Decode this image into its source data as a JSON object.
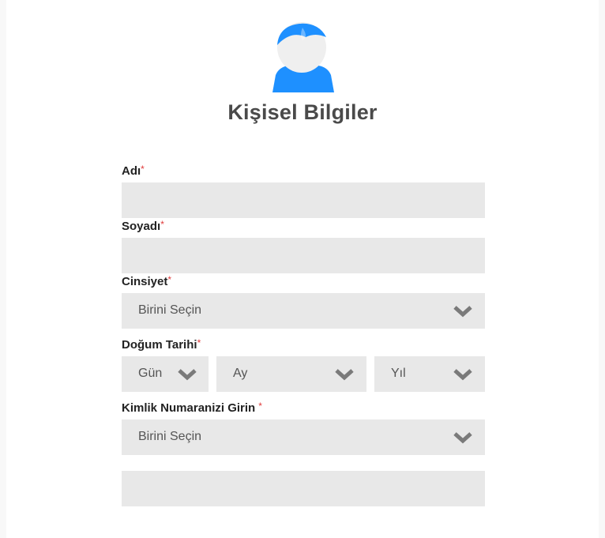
{
  "header": {
    "title": "Kişisel Bilgiler",
    "avatar_icon": "user-avatar-icon",
    "accent_color": "#1e90ff"
  },
  "form": {
    "first_name": {
      "label": "Adı",
      "required_mark": "*",
      "value": ""
    },
    "last_name": {
      "label": "Soyadı",
      "required_mark": "*",
      "value": ""
    },
    "gender": {
      "label": "Cinsiyet",
      "required_mark": "*",
      "selected": "Birini Seçin",
      "icon": "chevron-down-icon"
    },
    "birth_date": {
      "label": "Doğum Tarihi",
      "required_mark": "*",
      "day": "Gün",
      "month": "Ay",
      "year": "Yıl"
    },
    "id_type": {
      "label": "Kimlik Numaranizi Girin",
      "required_mark": "*",
      "selected": "Birini Seçin"
    },
    "id_number": {
      "value": ""
    }
  }
}
